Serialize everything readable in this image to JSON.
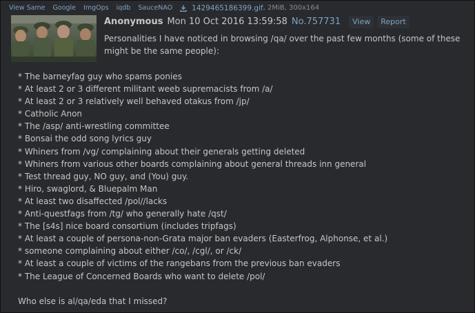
{
  "file_bar": {
    "links": [
      "View Same",
      "Google",
      "ImgOps",
      "iqdb",
      "SauceNAO"
    ],
    "download_icon": "download-icon",
    "file_name": "1429465186399.gif",
    "file_info": ", 2MiB, 300x164"
  },
  "post": {
    "name": "Anonymous",
    "date": "Mon 10 Oct 2016 13:59:58",
    "number": "No.757731",
    "view_label": "View",
    "report_label": "Report",
    "intro": "Personalities I have noticed in browsing /qa/ over the past few months (some of these might be the same people):",
    "items": [
      "* The barneyfag guy who spams ponies",
      "* At least 2 or 3 different militant weeb supremacists from /a/",
      "* At least 2 or 3 relatively well behaved otakus from /jp/",
      "* Catholic Anon",
      "* The /asp/ anti-wrestling committee",
      "* Bonsai the odd song lyrics guy",
      "* Whiners from /vg/ complaining about their generals getting deleted",
      "* Whiners from various other boards complaining about general threads inn general",
      "* Test thread guy, NO guy, and (You) guy.",
      "* Hiro, swaglord, & Bluepalm Man",
      "* At least two disaffected /pol//lacks",
      "* Anti-questfags from /tg/ who generally hate /qst/",
      "* The [s4s] nice board consortium (includes tripfags)",
      "* At least a couple of persona-non-Grata major ban evaders (Easterfrog, Alphonse, et al.)",
      "* someone complaining about either /co/, /cgl/, or /ck/",
      "* At least a couple of victims of the rangebans from the previous ban evaders",
      "* The League of Concerned Boards who want to delete /pol/"
    ],
    "closing": "Who else is al/qa/eda that I missed?"
  },
  "colors": {
    "background": "#282a2e",
    "text": "#c5c8c6",
    "link": "#81a2be"
  }
}
